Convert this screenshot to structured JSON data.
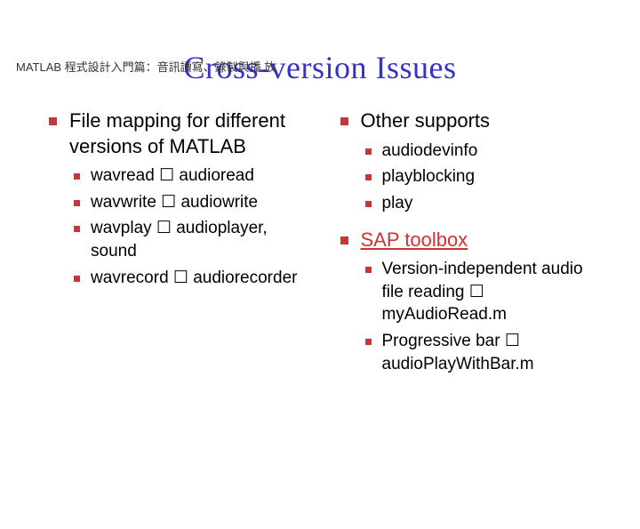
{
  "header": "MATLAB 程式設計入門篇：音訊讀寫、錄製與播 放",
  "title": "Cross-version Issues",
  "left": {
    "heading": "File mapping for different versions of MATLAB",
    "items": [
      "wavread ☐ audioread",
      "wavwrite ☐ audiowrite",
      "wavplay ☐ audioplayer, sound",
      "wavrecord ☐ audiorecorder"
    ]
  },
  "right": {
    "heading1": "Other supports",
    "items1": [
      "audiodevinfo",
      "playblocking",
      "play"
    ],
    "heading2": "SAP toolbox",
    "items2": [
      "Version-independent audio file reading ☐ myAudioRead.m",
      "Progressive bar ☐ audioPlayWithBar.m"
    ]
  }
}
